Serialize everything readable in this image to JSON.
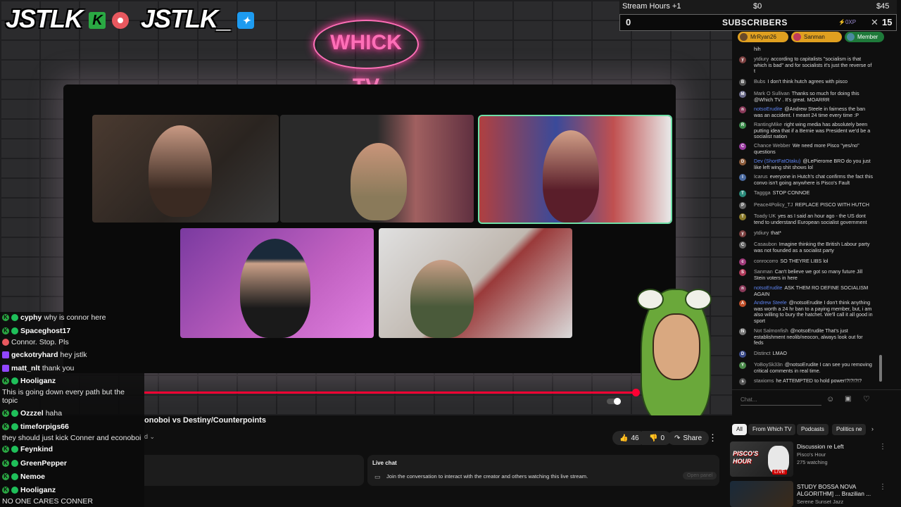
{
  "overlay_top": {
    "logo_left": "JSTLK",
    "logo_right": "JSTLK_",
    "neon_sign": "WHICK TV"
  },
  "stream_widget": {
    "hours_label": "Stream Hours +1",
    "amount1": "$0",
    "amount2": "$45",
    "count_left": "0",
    "subscribers_label": "SUBSCRIBERS",
    "xp_label": "0XP",
    "count_right": "15"
  },
  "video": {
    "title_partial": "onoboi vs Destiny/Counterpoints",
    "like_count": "46",
    "dislike_count": "0",
    "share_label": "Share",
    "progress": 0.99,
    "live_chat_label": "Live chat",
    "live_chat_prompt": "Join the conversation to interact with the creator and others watching this live stream.",
    "open_panel_label": "Open panel"
  },
  "overlay_chat": [
    {
      "user": "cyphy",
      "msg": "why is connor here",
      "badges": "green"
    },
    {
      "user": "Spaceghost17",
      "msg": "",
      "badges": "green"
    },
    {
      "user": "",
      "msg": "Connor. Stop. Pls",
      "badges": "red"
    },
    {
      "user": "geckotryhard",
      "msg": "hey jstlk",
      "badges": "purple"
    },
    {
      "user": "matt_nlt",
      "msg": "thank you",
      "badges": "purple"
    },
    {
      "user": "Hooliganz",
      "msg": "",
      "badges": "green"
    },
    {
      "user": "",
      "msg": "This is going down every path but the",
      "badges": "none"
    },
    {
      "user": "",
      "msg": "topic",
      "badges": "none"
    },
    {
      "user": "Ozzzel",
      "msg": "haha",
      "badges": "green"
    },
    {
      "user": "timeforpigs66",
      "msg": "",
      "badges": "green"
    },
    {
      "user": "",
      "msg": "they should just kick Conner and econoboi",
      "badges": "none"
    },
    {
      "user": "Feynkind",
      "msg": "",
      "badges": "green"
    },
    {
      "user": "GreenPepper",
      "msg": "",
      "badges": "green"
    },
    {
      "user": "Nemoe",
      "msg": "",
      "badges": "green"
    },
    {
      "user": "Hooliganz",
      "msg": "",
      "badges": "green"
    },
    {
      "user": "",
      "msg": "NO ONE CARES CONNER",
      "badges": "none"
    }
  ],
  "chat_pinned": {
    "pill1": "MrRyan26",
    "pill2": "Sanman",
    "pill3": "Member"
  },
  "chat_messages": [
    {
      "initial": "",
      "name": "",
      "text": "hih",
      "color": "#444"
    },
    {
      "initial": "y",
      "name": "ytdiury",
      "text": "according to capitalists \"socialism is that which is bad\" and for socialists it's just the reverse of t",
      "color": "#7b3f3f"
    },
    {
      "initial": "B",
      "name": "Bubs",
      "text": "I don't think hutch agrees with pisco",
      "color": "#555"
    },
    {
      "initial": "M",
      "name": "Mark O Sullivan",
      "text": "Thanks so much for doing this @Which TV . It's great. MOARRR",
      "color": "#6a6a8a"
    },
    {
      "initial": "n",
      "name": "notsoErudite",
      "text": "@Andrew Steele in fairness the ban was an accident. I meant 24 time every time :P",
      "color": "#8a3a5a",
      "mod": true
    },
    {
      "initial": "R",
      "name": "RantingMike",
      "text": "right wing media has absolutely been putting idea that if a Bernie was President we'd be a socialist nation",
      "color": "#3a8a4a"
    },
    {
      "initial": "C",
      "name": "Chance Webber",
      "text": "We need more Pisco \"yes/no\" questions",
      "color": "#9a3aa0"
    },
    {
      "initial": "D",
      "name": "Dev (ShortFatOtaku)",
      "text": "@LePierome BRO do you just like left wing shit shows lol",
      "color": "#8a5a3a",
      "mod": true
    },
    {
      "initial": "I",
      "name": "Icarus",
      "text": "everyone in Hutch's chat confirms the fact this convo isn't going anywhere is Pisco's Fault",
      "color": "#4a6aa0"
    },
    {
      "initial": "T",
      "name": "Taggga",
      "text": "STOP CONNOE",
      "color": "#2a8a7a"
    },
    {
      "initial": "P",
      "name": "Peace4Policy_TJ",
      "text": "REPLACE PISCO WITH HUTCH",
      "color": "#666"
    },
    {
      "initial": "T",
      "name": "Toady UK",
      "text": "yes as I said an hour ago - the US dont tend to understand European socialist government",
      "color": "#8a7a2a"
    },
    {
      "initial": "y",
      "name": "ytdiury",
      "text": "that*",
      "color": "#7b3f3f"
    },
    {
      "initial": "C",
      "name": "Casaubon",
      "text": "Imagine thinking the British Labour party was not founded as a socialist party",
      "color": "#666"
    },
    {
      "initial": "c",
      "name": "conrocorro",
      "text": "SO THEYRE LIBS lol",
      "color": "#a03a7a"
    },
    {
      "initial": "S",
      "name": "Sanman",
      "text": "Can't believe we got so many future Jill Stein voters in here",
      "color": "#b03a5a"
    },
    {
      "initial": "n",
      "name": "notsoErudite",
      "text": "ASK THEM RO DEFINE SOCIALISM AGAIN",
      "color": "#8a3a5a",
      "mod": true
    },
    {
      "initial": "A",
      "name": "Andrew Steele",
      "text": "@notsoErudite I don't think anything was worth a 24 hr ban to a paying member, but, i am also willing to bury the hatchet. We'll call it all good in sport",
      "color": "#c0502a",
      "mod": true
    },
    {
      "initial": "N",
      "name": "Not Salmonfish",
      "text": "@notsoErudite That's just establishment neolib/neocon, always look out for feds",
      "color": "#777"
    },
    {
      "initial": "D",
      "name": "Distinct",
      "text": "LMAO",
      "color": "#3a4a8a"
    },
    {
      "initial": "Y",
      "name": "YoBoySk33n",
      "text": "@notsoErudite I can see you removing critical comments in real time.",
      "color": "#4a8a4a"
    },
    {
      "initial": "s",
      "name": "staxioms",
      "text": "he ATTEMPTED to hold power!?!?!?!?",
      "color": "#555"
    }
  ],
  "chat_input": {
    "placeholder": "Chat..."
  },
  "recommend_chips": [
    "All",
    "From Which TV",
    "Podcasts",
    "Politics ne"
  ],
  "recommendations": [
    {
      "title": "Discussion re Left",
      "channel": "Pisco's Hour",
      "meta": "275 watching",
      "thumb_text": "PISCO'S HOUR",
      "badge": "LIVE"
    },
    {
      "title": "STUDY BOSSA NOVA ALGORITHM] ... Brazilian ...",
      "channel": "Serene Sunset Jazz",
      "meta": "",
      "thumb_text": "",
      "badge": ""
    }
  ],
  "colors": {
    "accent_red": "#ff0033",
    "active_tile": "#6fe0a8",
    "neon": "#ff6fb7"
  }
}
